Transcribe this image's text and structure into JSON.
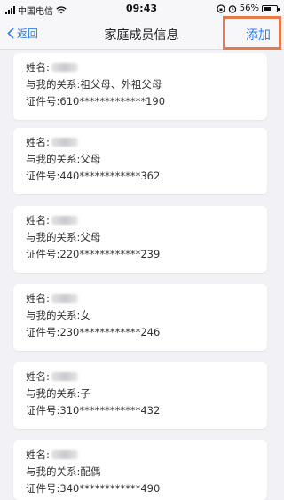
{
  "status_bar": {
    "carrier": "中国电信",
    "time": "09:43",
    "battery": "56%"
  },
  "nav": {
    "back_label": "返回",
    "title": "家庭成员信息",
    "add_label": "添加"
  },
  "labels": {
    "name": "姓名:",
    "relation": "与我的关系:",
    "id_number": "证件号:"
  },
  "members": [
    {
      "relation": "祖父母、外祖父母",
      "id_number": "610*************190"
    },
    {
      "relation": "父母",
      "id_number": "440************362"
    },
    {
      "relation": "父母",
      "id_number": "220************239"
    },
    {
      "relation": "女",
      "id_number": "230************246"
    },
    {
      "relation": "子",
      "id_number": "310************432"
    },
    {
      "relation": "配偶",
      "id_number": "340************490"
    }
  ]
}
